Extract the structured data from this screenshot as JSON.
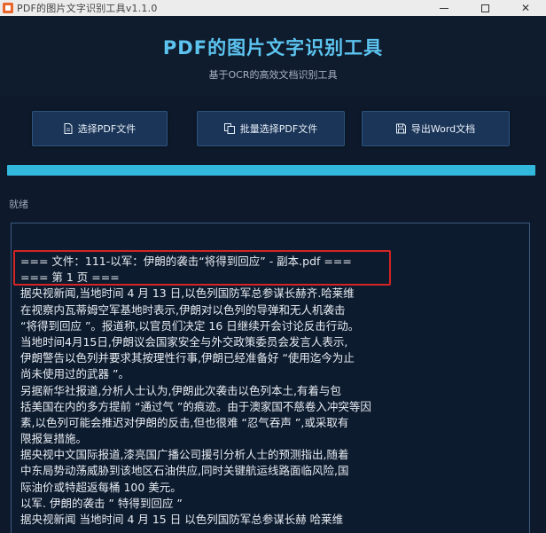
{
  "window": {
    "title": "PDF的图片文字识别工具v1.1.0"
  },
  "header": {
    "title": "PDF的图片文字识别工具",
    "subtitle": "基于OCR的高效文档识别工具"
  },
  "toolbar": {
    "buttons": [
      {
        "label": "选择PDF文件",
        "icon": "document-icon"
      },
      {
        "label": "批量选择PDF文件",
        "icon": "multi-document-icon"
      },
      {
        "label": "导出Word文档",
        "icon": "save-icon"
      }
    ]
  },
  "progress": {
    "value": 1.0
  },
  "status": {
    "text": "就绪"
  },
  "output": {
    "lines": [
      "=== 文件：111-以军：伊朗的袭击“将得到回应” - 副本.pdf ===",
      "=== 第 1 页 ===",
      "据央视新闻,当地时间 4 月 13 日,以色列国防军总参谋长赫齐.哈莱维",
      "在视察内瓦蒂姆空军基地时表示,伊朗对以色列的导弹和无人机袭击",
      "“将得到回应 ”。报道称,以官员们决定 16 日继续开会讨论反击行动。",
      "当地时间4月15日,伊朗议会国家安全与外交政策委员会发言人表示,",
      "伊朗警告以色列并要求其按理性行事,伊朗已经准备好 “使用迄今为止",
      "尚未使用过的武器 ”。",
      "另据新华社报道,分析人士认为,伊朗此次袭击以色列本土,有着与包",
      "括美国在内的多方提前 “通过气 ”的痕迹。由于澳家国不慈卷入冲突等因",
      "素,以色列可能会推迟对伊朗的反击,但也很难 “忍气吞声 ”,或采取有",
      "限报复措施。",
      "据央视中文国际报道,漆亮国广播公司援引分析人士的预测指出,随着",
      "中东局势动荡威胁到该地区石油供应,同时关键航运线路面临风险,国",
      "际油价或特超返每桶 100 美元。",
      "以军. 伊朗的袭击 ” 特得到回应 ”",
      "据央视新闻 当地时间 4 月 15 日 以色列国防军总参谋长赫 哈莱维"
    ]
  }
}
